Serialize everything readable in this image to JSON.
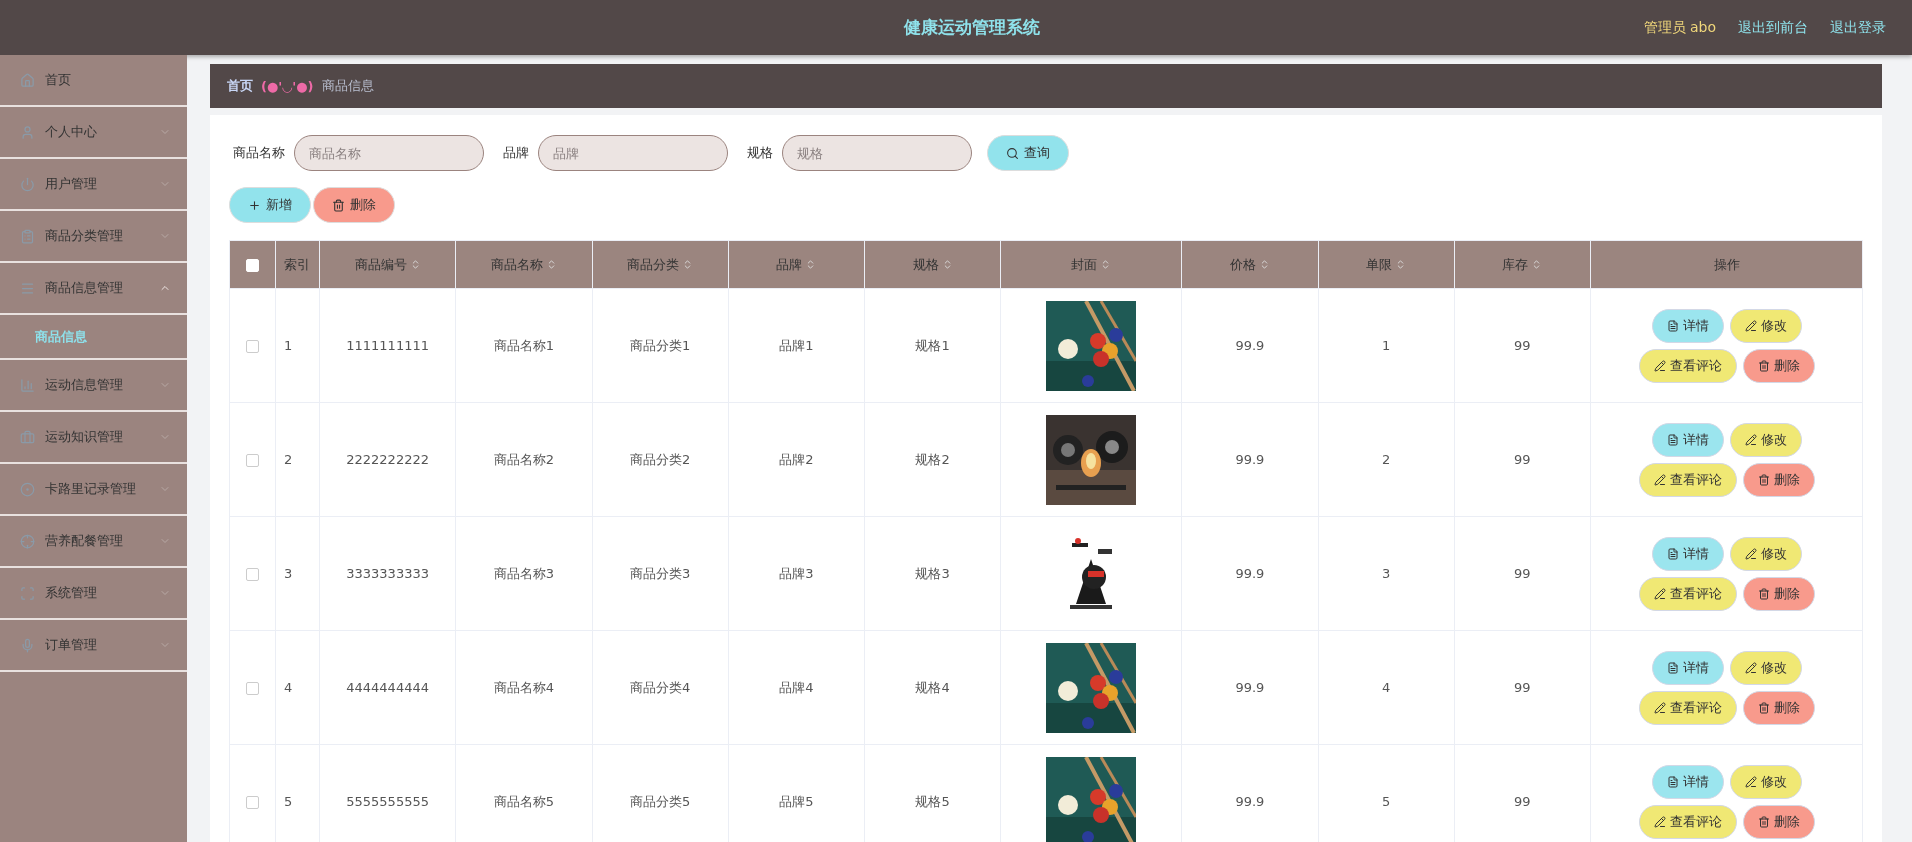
{
  "header": {
    "title": "健康运动管理系统",
    "user": "管理员 abo",
    "links": [
      "退出到前台",
      "退出登录"
    ]
  },
  "sidebar": {
    "items": [
      {
        "label": "首页"
      },
      {
        "label": "个人中心",
        "expanded": false
      },
      {
        "label": "用户管理",
        "expanded": false
      },
      {
        "label": "商品分类管理",
        "expanded": false
      },
      {
        "label": "商品信息管理",
        "expanded": true,
        "children": [
          {
            "label": "商品信息",
            "selected": true
          }
        ]
      },
      {
        "label": "运动信息管理",
        "expanded": false
      },
      {
        "label": "运动知识管理",
        "expanded": false
      },
      {
        "label": "卡路里记录管理",
        "expanded": false
      },
      {
        "label": "营养配餐管理",
        "expanded": false
      },
      {
        "label": "系统管理",
        "expanded": false
      },
      {
        "label": "订单管理",
        "expanded": false
      }
    ]
  },
  "breadcrumb": {
    "home": "首页",
    "separator": "(●'◡'●)",
    "current": "商品信息"
  },
  "search": {
    "fields": [
      {
        "label": "商品名称",
        "placeholder": "商品名称"
      },
      {
        "label": "品牌",
        "placeholder": "品牌"
      },
      {
        "label": "规格",
        "placeholder": "规格"
      }
    ],
    "button": "查询"
  },
  "toolbar": [
    {
      "label": "新增",
      "kind": "add"
    },
    {
      "label": "删除",
      "kind": "delete"
    }
  ],
  "table": {
    "select_all": {
      "checked": false
    },
    "columns": [
      {
        "label": "索引",
        "sortable": false
      },
      {
        "label": "商品编号",
        "sortable": true
      },
      {
        "label": "商品名称",
        "sortable": true
      },
      {
        "label": "商品分类",
        "sortable": true
      },
      {
        "label": "品牌",
        "sortable": true
      },
      {
        "label": "规格",
        "sortable": true
      },
      {
        "label": "封面",
        "sortable": true
      },
      {
        "label": "价格",
        "sortable": true
      },
      {
        "label": "单限",
        "sortable": true
      },
      {
        "label": "库存",
        "sortable": true
      },
      {
        "label": "操作",
        "sortable": false
      }
    ],
    "rows": [
      {
        "checked": false,
        "cells": [
          "1",
          "1111111111",
          "商品名称1",
          "商品分类1",
          "品牌1",
          "规格1"
        ],
        "cover": {
          "kind": "billiards"
        },
        "tail": [
          "99.9",
          "1",
          "99"
        ],
        "actions": [
          {
            "label": "详情",
            "kind": "detail"
          },
          {
            "label": "修改",
            "kind": "edit"
          },
          {
            "label": "查看评论",
            "kind": "comment"
          },
          {
            "label": "删除",
            "kind": "delete"
          }
        ]
      },
      {
        "checked": false,
        "cells": [
          "2",
          "2222222222",
          "商品名称2",
          "商品分类2",
          "品牌2",
          "规格2"
        ],
        "cover": {
          "kind": "gym"
        },
        "tail": [
          "99.9",
          "2",
          "99"
        ],
        "actions": [
          {
            "label": "详情",
            "kind": "detail"
          },
          {
            "label": "修改",
            "kind": "edit"
          },
          {
            "label": "查看评论",
            "kind": "comment"
          },
          {
            "label": "删除",
            "kind": "delete"
          }
        ]
      },
      {
        "checked": false,
        "cells": [
          "3",
          "3333333333",
          "商品名称3",
          "商品分类3",
          "品牌3",
          "规格3"
        ],
        "cover": {
          "kind": "bike"
        },
        "tail": [
          "99.9",
          "3",
          "99"
        ],
        "actions": [
          {
            "label": "详情",
            "kind": "detail"
          },
          {
            "label": "修改",
            "kind": "edit"
          },
          {
            "label": "查看评论",
            "kind": "comment"
          },
          {
            "label": "删除",
            "kind": "delete"
          }
        ]
      },
      {
        "checked": false,
        "cells": [
          "4",
          "4444444444",
          "商品名称4",
          "商品分类4",
          "品牌4",
          "规格4"
        ],
        "cover": {
          "kind": "billiards"
        },
        "tail": [
          "99.9",
          "4",
          "99"
        ],
        "actions": [
          {
            "label": "详情",
            "kind": "detail"
          },
          {
            "label": "修改",
            "kind": "edit"
          },
          {
            "label": "查看评论",
            "kind": "comment"
          },
          {
            "label": "删除",
            "kind": "delete"
          }
        ]
      },
      {
        "checked": false,
        "cells": [
          "5",
          "5555555555",
          "商品名称5",
          "商品分类5",
          "品牌5",
          "规格5"
        ],
        "cover": {
          "kind": "billiards"
        },
        "tail": [
          "99.9",
          "5",
          "99"
        ],
        "actions": [
          {
            "label": "详情",
            "kind": "detail"
          },
          {
            "label": "修改",
            "kind": "edit"
          },
          {
            "label": "查看评论",
            "kind": "comment"
          },
          {
            "label": "删除",
            "kind": "delete"
          }
        ]
      }
    ]
  }
}
